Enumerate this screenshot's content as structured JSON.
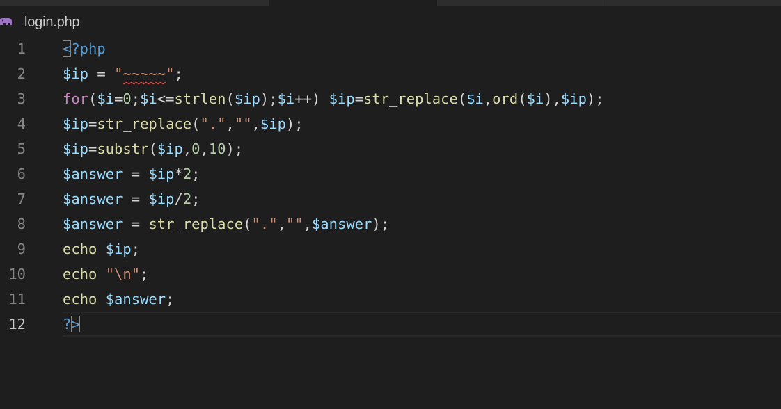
{
  "editor": {
    "filename": "login.php",
    "file_icon": "php-elephant-icon",
    "colors": {
      "background": "#1e1e1e",
      "keyword": "#c586c0",
      "variable": "#9cdcfe",
      "function": "#dcdcaa",
      "string": "#ce9178",
      "number": "#b5cea8",
      "tag": "#569cd6",
      "punctuation": "#d4d4d4",
      "line_number": "#858585",
      "php_icon": "#a074c4"
    },
    "current_line": 12,
    "lines": [
      {
        "n": "1",
        "tokens": [
          {
            "t": "<",
            "c": "tag",
            "match": true
          },
          {
            "t": "?php",
            "c": "tag"
          }
        ]
      },
      {
        "n": "2",
        "tokens": [
          {
            "t": "$ip",
            "c": "var"
          },
          {
            "t": " = ",
            "c": "punct"
          },
          {
            "t": "\"",
            "c": "str"
          },
          {
            "t": "~~~~~",
            "c": "str",
            "squiggle": true
          },
          {
            "t": "\"",
            "c": "str"
          },
          {
            "t": ";",
            "c": "punct"
          }
        ]
      },
      {
        "n": "3",
        "tokens": [
          {
            "t": "for",
            "c": "keyword"
          },
          {
            "t": "(",
            "c": "punct"
          },
          {
            "t": "$i",
            "c": "var"
          },
          {
            "t": "=",
            "c": "punct"
          },
          {
            "t": "0",
            "c": "num"
          },
          {
            "t": ";",
            "c": "punct"
          },
          {
            "t": "$i",
            "c": "var"
          },
          {
            "t": "<=",
            "c": "punct"
          },
          {
            "t": "strlen",
            "c": "fn"
          },
          {
            "t": "(",
            "c": "punct"
          },
          {
            "t": "$ip",
            "c": "var"
          },
          {
            "t": ");",
            "c": "punct"
          },
          {
            "t": "$i",
            "c": "var"
          },
          {
            "t": "++) ",
            "c": "punct"
          },
          {
            "t": "$ip",
            "c": "var"
          },
          {
            "t": "=",
            "c": "punct"
          },
          {
            "t": "str_replace",
            "c": "fn"
          },
          {
            "t": "(",
            "c": "punct"
          },
          {
            "t": "$i",
            "c": "var"
          },
          {
            "t": ",",
            "c": "punct"
          },
          {
            "t": "ord",
            "c": "fn"
          },
          {
            "t": "(",
            "c": "punct"
          },
          {
            "t": "$i",
            "c": "var"
          },
          {
            "t": "),",
            "c": "punct"
          },
          {
            "t": "$ip",
            "c": "var"
          },
          {
            "t": ");",
            "c": "punct"
          }
        ]
      },
      {
        "n": "4",
        "tokens": [
          {
            "t": "$ip",
            "c": "var"
          },
          {
            "t": "=",
            "c": "punct"
          },
          {
            "t": "str_replace",
            "c": "fn"
          },
          {
            "t": "(",
            "c": "punct"
          },
          {
            "t": "\".\"",
            "c": "str"
          },
          {
            "t": ",",
            "c": "punct"
          },
          {
            "t": "\"\"",
            "c": "str"
          },
          {
            "t": ",",
            "c": "punct"
          },
          {
            "t": "$ip",
            "c": "var"
          },
          {
            "t": ");",
            "c": "punct"
          }
        ]
      },
      {
        "n": "5",
        "tokens": [
          {
            "t": "$ip",
            "c": "var"
          },
          {
            "t": "=",
            "c": "punct"
          },
          {
            "t": "substr",
            "c": "fn"
          },
          {
            "t": "(",
            "c": "punct"
          },
          {
            "t": "$ip",
            "c": "var"
          },
          {
            "t": ",",
            "c": "punct"
          },
          {
            "t": "0",
            "c": "num"
          },
          {
            "t": ",",
            "c": "punct"
          },
          {
            "t": "10",
            "c": "num"
          },
          {
            "t": ");",
            "c": "punct"
          }
        ]
      },
      {
        "n": "6",
        "tokens": [
          {
            "t": "$answer",
            "c": "var"
          },
          {
            "t": " = ",
            "c": "punct"
          },
          {
            "t": "$ip",
            "c": "var"
          },
          {
            "t": "*",
            "c": "punct"
          },
          {
            "t": "2",
            "c": "num"
          },
          {
            "t": ";",
            "c": "punct"
          }
        ]
      },
      {
        "n": "7",
        "tokens": [
          {
            "t": "$answer",
            "c": "var"
          },
          {
            "t": " = ",
            "c": "punct"
          },
          {
            "t": "$ip",
            "c": "var"
          },
          {
            "t": "/",
            "c": "punct"
          },
          {
            "t": "2",
            "c": "num"
          },
          {
            "t": ";",
            "c": "punct"
          }
        ]
      },
      {
        "n": "8",
        "tokens": [
          {
            "t": "$answer",
            "c": "var"
          },
          {
            "t": " = ",
            "c": "punct"
          },
          {
            "t": "str_replace",
            "c": "fn"
          },
          {
            "t": "(",
            "c": "punct"
          },
          {
            "t": "\".\"",
            "c": "str"
          },
          {
            "t": ",",
            "c": "punct"
          },
          {
            "t": "\"\"",
            "c": "str"
          },
          {
            "t": ",",
            "c": "punct"
          },
          {
            "t": "$answer",
            "c": "var"
          },
          {
            "t": ");",
            "c": "punct"
          }
        ]
      },
      {
        "n": "9",
        "tokens": [
          {
            "t": "echo",
            "c": "fn"
          },
          {
            "t": " ",
            "c": "punct"
          },
          {
            "t": "$ip",
            "c": "var"
          },
          {
            "t": ";",
            "c": "punct"
          }
        ]
      },
      {
        "n": "10",
        "tokens": [
          {
            "t": "echo",
            "c": "fn"
          },
          {
            "t": " ",
            "c": "punct"
          },
          {
            "t": "\"",
            "c": "str"
          },
          {
            "t": "\\n",
            "c": "str"
          },
          {
            "t": "\"",
            "c": "str"
          },
          {
            "t": ";",
            "c": "punct"
          }
        ]
      },
      {
        "n": "11",
        "tokens": [
          {
            "t": "echo",
            "c": "fn"
          },
          {
            "t": " ",
            "c": "punct"
          },
          {
            "t": "$answer",
            "c": "var"
          },
          {
            "t": ";",
            "c": "punct"
          }
        ]
      },
      {
        "n": "12",
        "tokens": [
          {
            "t": "?",
            "c": "tag"
          },
          {
            "t": ">",
            "c": "tag",
            "match": true
          }
        ]
      }
    ]
  }
}
